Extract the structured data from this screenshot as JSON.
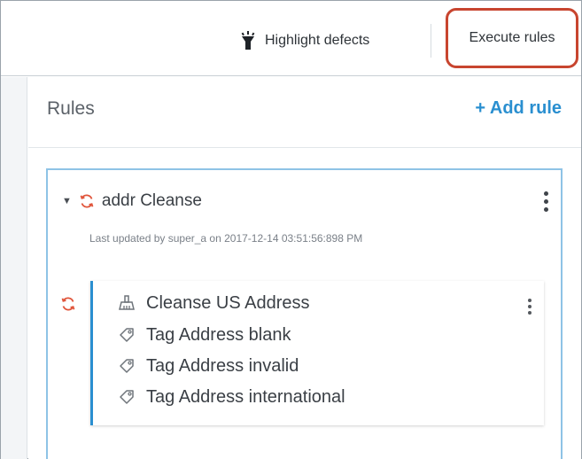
{
  "toolbar": {
    "highlight_label": "Highlight defects",
    "execute_label": "Execute rules"
  },
  "panel": {
    "title": "Rules",
    "add_rule_label": "+ Add rule"
  },
  "rule": {
    "name": "addr Cleanse",
    "meta": "Last updated by super_a on 2017-12-14 03:51:56:898 PM",
    "steps": [
      {
        "label": "Cleanse US Address",
        "icon": "cleanse-icon"
      },
      {
        "label": "Tag Address blank",
        "icon": "tag-icon"
      },
      {
        "label": "Tag Address invalid",
        "icon": "tag-icon"
      },
      {
        "label": "Tag Address international",
        "icon": "tag-icon"
      }
    ]
  },
  "colors": {
    "accent": "#2a8fd0",
    "sync": "#e0553b",
    "highlight_box": "#c8452f",
    "card_border": "#8ec3e6"
  }
}
